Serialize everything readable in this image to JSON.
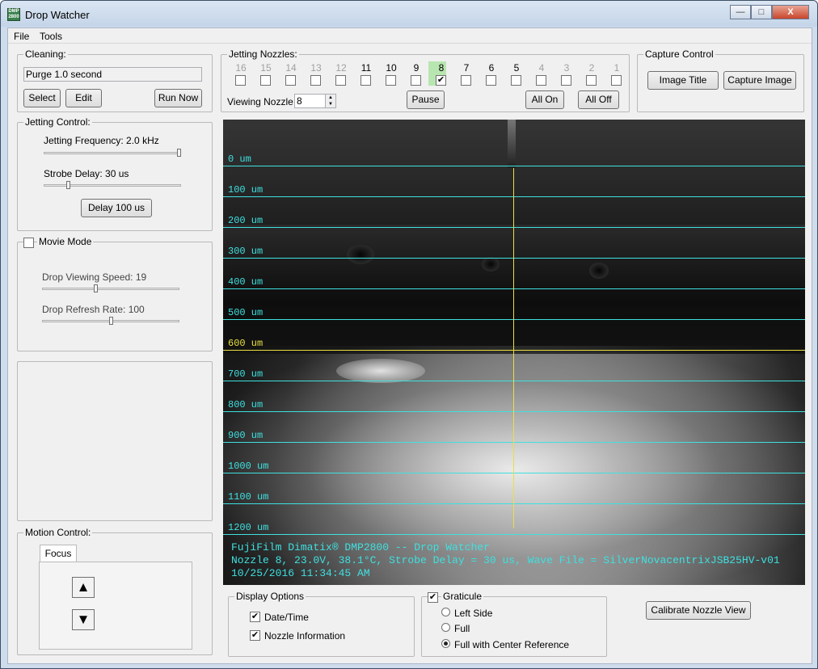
{
  "window": {
    "title": "Drop Watcher",
    "minimize": "—",
    "maximize": "□",
    "close": "X"
  },
  "menu": {
    "file": "File",
    "tools": "Tools"
  },
  "cleaning": {
    "legend": "Cleaning:",
    "value": "Purge 1.0 second",
    "select": "Select",
    "edit": "Edit",
    "run_now": "Run Now"
  },
  "jetting_nozzles": {
    "legend": "Jetting Nozzles:",
    "numbers": [
      "16",
      "15",
      "14",
      "13",
      "12",
      "11",
      "10",
      "9",
      "8",
      "7",
      "6",
      "5",
      "4",
      "3",
      "2",
      "1"
    ],
    "active": [
      false,
      false,
      false,
      false,
      false,
      true,
      true,
      true,
      true,
      true,
      true,
      true,
      false,
      false,
      false,
      false
    ],
    "checked": [
      false,
      false,
      false,
      false,
      false,
      false,
      false,
      false,
      true,
      false,
      false,
      false,
      false,
      false,
      false,
      false
    ],
    "viewing_label": "Viewing Nozzle:",
    "viewing_value": "8",
    "pause": "Pause",
    "all_on": "All On",
    "all_off": "All Off",
    "highlight_color": "#b8e6b0"
  },
  "capture": {
    "legend": "Capture Control",
    "image_title": "Image Title",
    "capture_image": "Capture Image"
  },
  "jetting_control": {
    "legend": "Jetting Control:",
    "freq_label": "Jetting Frequency:  2.0 kHz",
    "freq_level": 1.0,
    "strobe_label": "Strobe Delay:  30 us",
    "strobe_level": 0.17,
    "delay_button": "Delay 100 us"
  },
  "movie": {
    "label": "Movie Mode",
    "checked": false,
    "speed_label": "Drop Viewing Speed:  19",
    "speed_level": 0.39,
    "refresh_label": "Drop Refresh Rate:  100",
    "refresh_level": 0.5
  },
  "motion": {
    "legend": "Motion Control:",
    "tab": "Focus",
    "up": "▲",
    "down": "▼"
  },
  "graticule": {
    "labels": [
      "0 um",
      "100 um",
      "200 um",
      "300 um",
      "400 um",
      "500 um",
      "600 um",
      "700 um",
      "800 um",
      "900 um",
      "1000 um",
      "1100 um",
      "1200 um"
    ],
    "color": "#3fe0e0",
    "reference_color": "#e8e040",
    "reference_index": 6
  },
  "overlay": {
    "line1": "FujiFilm Dimatix® DMP2800 -- Drop Watcher",
    "line2": "Nozzle 8, 23.0V, 38.1°C, Strobe Delay = 30 us, Wave File = SilverNovacentrixJSB25HV-v01",
    "line3": "10/25/2016 11:34:45 AM"
  },
  "display_options": {
    "legend": "Display Options",
    "date_time": "Date/Time",
    "date_time_checked": true,
    "nozzle_info": "Nozzle Information",
    "nozzle_info_checked": true
  },
  "graticule_group": {
    "legend": "Graticule",
    "checked": true,
    "options": [
      "Left Side",
      "Full",
      "Full with Center Reference"
    ],
    "selected": 2
  },
  "calibrate": "Calibrate Nozzle View"
}
